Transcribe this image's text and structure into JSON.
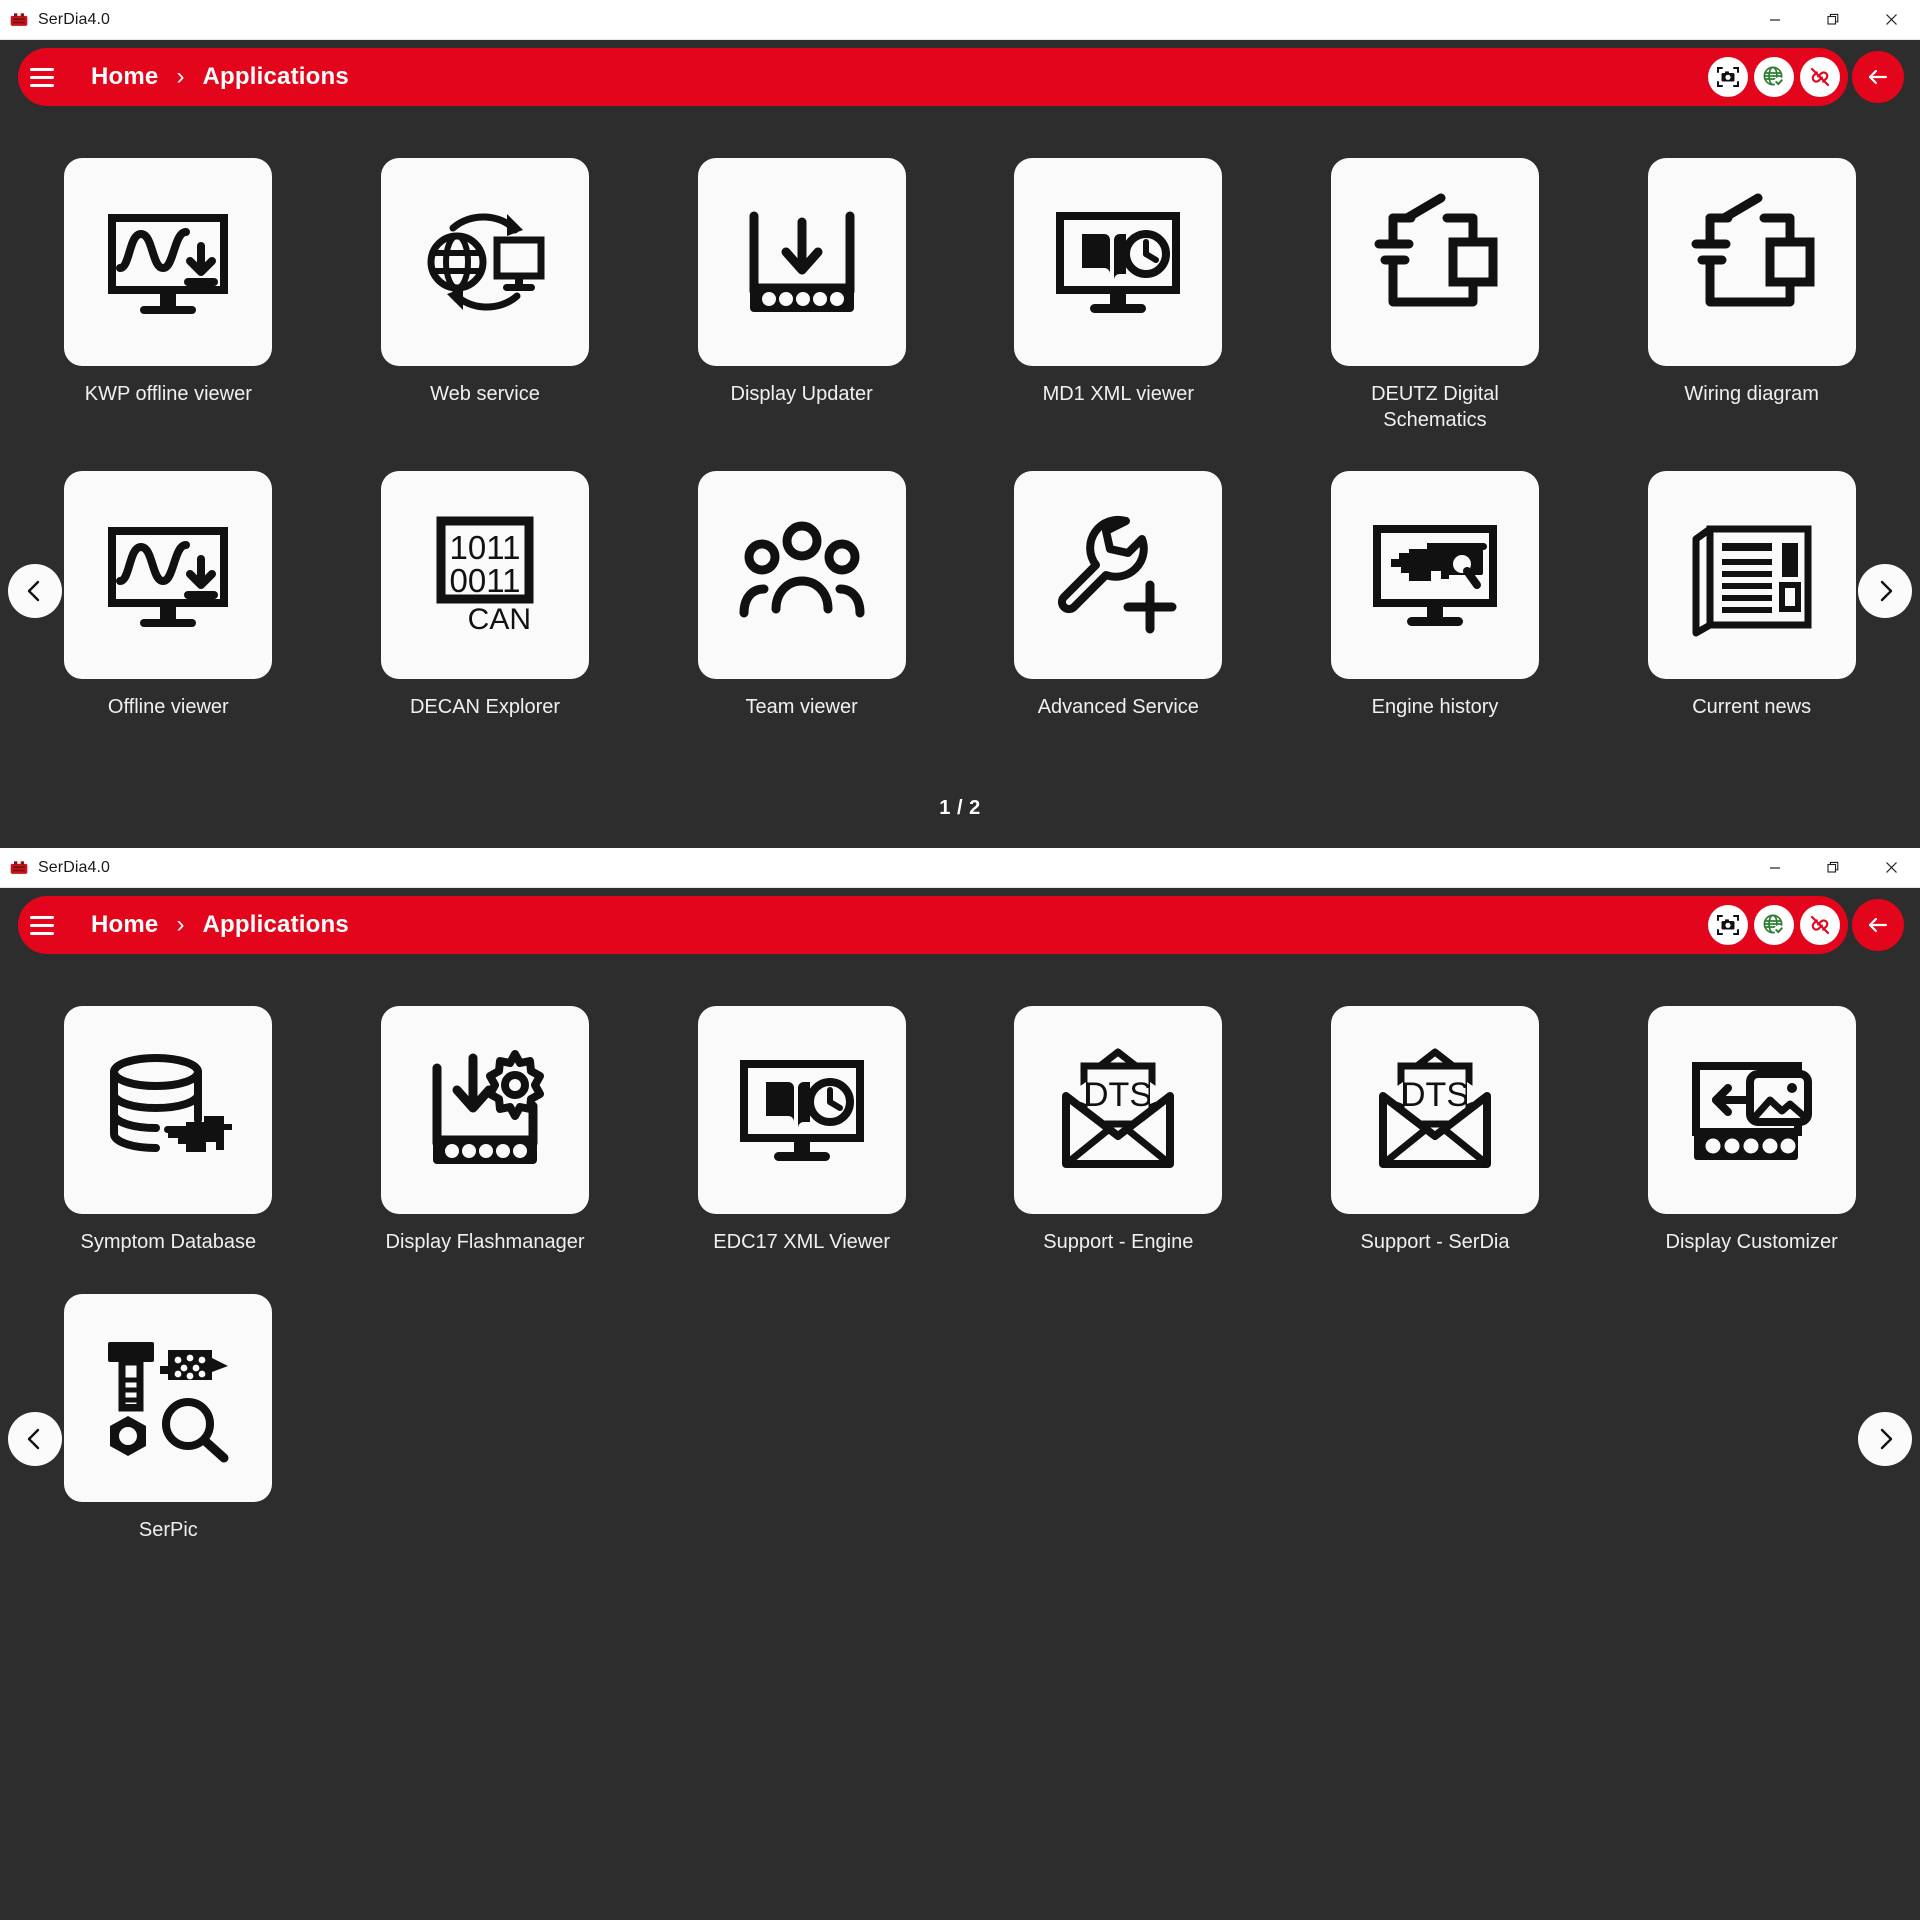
{
  "window1": {
    "titlebar": {
      "title": "SerDia4.0",
      "minimize": "minimize",
      "restore": "restore",
      "close": "close"
    },
    "header": {
      "menu": "menu",
      "breadcrumb": [
        "Home",
        "Applications"
      ],
      "separator": "›",
      "icons": [
        "screenshot-camera-icon",
        "globe-online-icon",
        "disconnect-link-icon"
      ],
      "back": "back"
    },
    "nav": {
      "prev": "previous-page",
      "next": "next-page"
    },
    "pager": "1 / 2",
    "tiles": [
      {
        "label": "KWP offline viewer",
        "icon": "monitor-waveform-download-icon"
      },
      {
        "label": "Web service",
        "icon": "globe-monitor-sync-icon"
      },
      {
        "label": "Display Updater",
        "icon": "display-download-arrow-icon"
      },
      {
        "label": "MD1 XML viewer",
        "icon": "monitor-book-clock-icon"
      },
      {
        "label": "DEUTZ Digital Schematics",
        "icon": "circuit-switch-battery-resistor-icon"
      },
      {
        "label": "Wiring diagram",
        "icon": "circuit-switch-battery-resistor-icon"
      },
      {
        "label": "Offline viewer",
        "icon": "monitor-waveform-download-icon"
      },
      {
        "label": "DECAN Explorer",
        "icon": "binary-can-icon",
        "binary": [
          "1011",
          "0011"
        ],
        "bus": "CAN"
      },
      {
        "label": "Team viewer",
        "icon": "people-group-icon"
      },
      {
        "label": "Advanced Service",
        "icon": "wrench-plus-icon"
      },
      {
        "label": "Engine history",
        "icon": "monitor-engine-magnifier-icon"
      },
      {
        "label": "Current news",
        "icon": "newspaper-icon"
      }
    ]
  },
  "window2": {
    "titlebar": {
      "title": "SerDia4.0",
      "minimize": "minimize",
      "restore": "restore",
      "close": "close"
    },
    "header": {
      "menu": "menu",
      "breadcrumb": [
        "Home",
        "Applications"
      ],
      "separator": "›",
      "icons": [
        "screenshot-camera-icon",
        "globe-online-icon",
        "disconnect-link-icon"
      ],
      "back": "back"
    },
    "nav": {
      "prev": "previous-page",
      "next": "next-page"
    },
    "tiles": [
      {
        "label": "Symptom Database",
        "icon": "database-engine-icon"
      },
      {
        "label": "Display Flashmanager",
        "icon": "display-download-gear-icon"
      },
      {
        "label": "EDC17 XML Viewer",
        "icon": "monitor-book-clock-icon"
      },
      {
        "label": "Support - Engine",
        "icon": "envelope-dts-icon",
        "letter": "DTS"
      },
      {
        "label": "Support - SerDia",
        "icon": "envelope-dts-icon",
        "letter": "DTS"
      },
      {
        "label": "Display Customizer",
        "icon": "display-image-arrow-icon"
      },
      {
        "label": "SerPic",
        "icon": "bolt-filter-nut-magnifier-icon"
      }
    ]
  },
  "colors": {
    "brand_red": "#e3051b",
    "background": "#2d2d2d",
    "tile": "#fafafa",
    "titlebar": "#ffffff",
    "text": "#f0f0f0"
  }
}
